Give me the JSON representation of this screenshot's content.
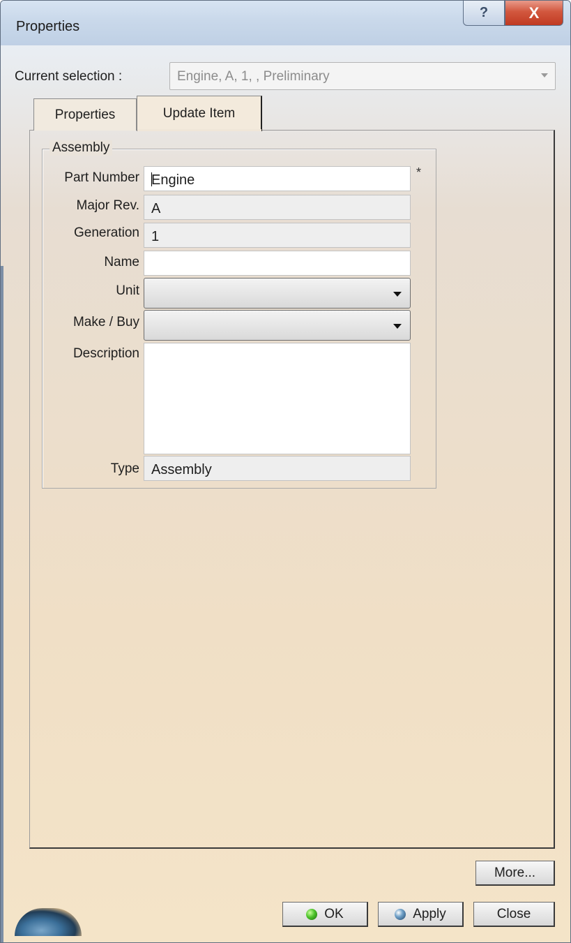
{
  "window": {
    "title": "Properties",
    "help_label": "?",
    "close_label": "X"
  },
  "current_selection": {
    "label": "Current selection :",
    "value": "Engine, A, 1, , Preliminary"
  },
  "tabs": [
    {
      "label": "Properties",
      "active": false
    },
    {
      "label": "Update Item",
      "active": true
    }
  ],
  "assembly_group": {
    "title": "Assembly",
    "fields": {
      "part_number": {
        "label": "Part Number",
        "value": "Engine",
        "required_marker": "*"
      },
      "major_rev": {
        "label": "Major Rev.",
        "value": "A"
      },
      "generation": {
        "label": "Generation",
        "value": "1"
      },
      "name": {
        "label": "Name",
        "value": ""
      },
      "unit": {
        "label": "Unit",
        "value": ""
      },
      "make_buy": {
        "label": "Make / Buy",
        "value": ""
      },
      "description": {
        "label": "Description",
        "value": ""
      },
      "type": {
        "label": "Type",
        "value": "Assembly"
      }
    }
  },
  "buttons": {
    "more": "More...",
    "ok": "OK",
    "apply": "Apply",
    "close": "Close"
  },
  "icons": {
    "ok": "green-orb-icon",
    "apply": "blue-orb-icon",
    "logo": "catia-logo-icon"
  },
  "colors": {
    "title_bar": "#c9d8ea",
    "close_button": "#c03a22",
    "background_bottom": "#f4e4c8"
  }
}
